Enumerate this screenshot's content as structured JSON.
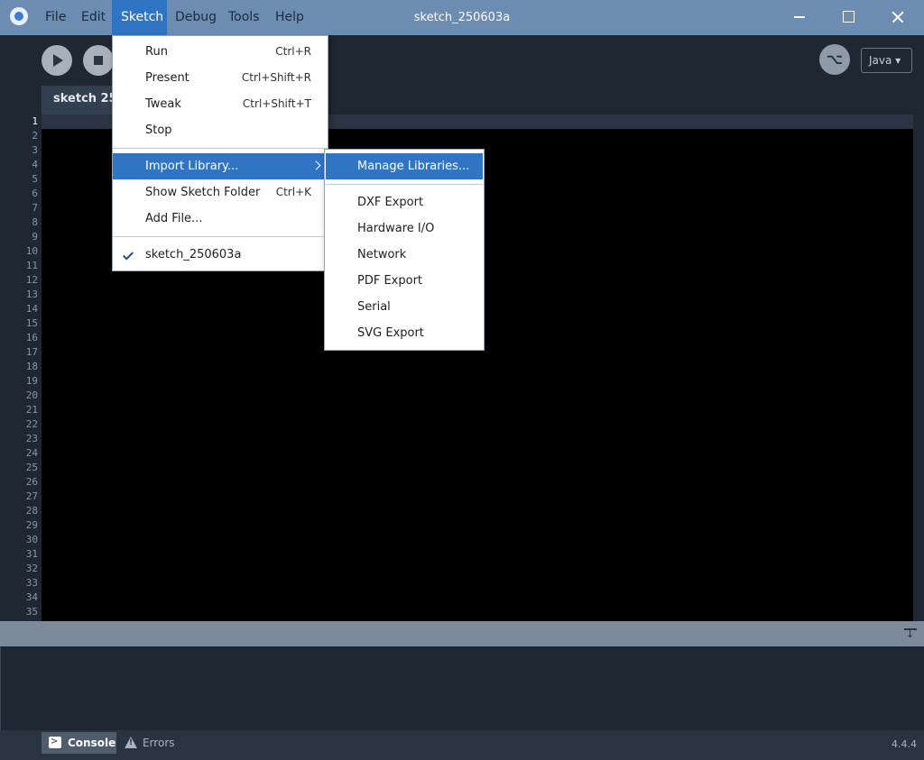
{
  "window": {
    "title": "sketch_250603a"
  },
  "menubar": {
    "file": "File",
    "edit": "Edit",
    "sketch": "Sketch",
    "debug": "Debug",
    "tools": "Tools",
    "help": "Help"
  },
  "toolbar": {
    "mode": "Java ▾",
    "debugger_glyph": "⌥"
  },
  "tab": {
    "label": "sketch 250603a"
  },
  "editor": {
    "current_line": 1,
    "line_count": 35
  },
  "sketch_menu": {
    "run": {
      "label": "Run",
      "shortcut": "Ctrl+R"
    },
    "present": {
      "label": "Present",
      "shortcut": "Ctrl+Shift+R"
    },
    "tweak": {
      "label": "Tweak",
      "shortcut": "Ctrl+Shift+T"
    },
    "stop": {
      "label": "Stop"
    },
    "import_library": {
      "label": "Import Library..."
    },
    "show_folder": {
      "label": "Show Sketch Folder",
      "shortcut": "Ctrl+K"
    },
    "add_file": {
      "label": "Add File..."
    },
    "current_sketch": {
      "label": "sketch_250603a"
    }
  },
  "library_menu": {
    "manage": "Manage Libraries...",
    "items": [
      "DXF Export",
      "Hardware I/O",
      "Network",
      "PDF Export",
      "Serial",
      "SVG Export"
    ]
  },
  "bottom": {
    "console": "Console",
    "errors": "Errors",
    "version": "4.4.4"
  },
  "colors": {
    "title_bar": "#6c8cb1",
    "highlight": "#3074c4",
    "editor_bg": "#000000",
    "chrome_bg": "#1f2733"
  }
}
